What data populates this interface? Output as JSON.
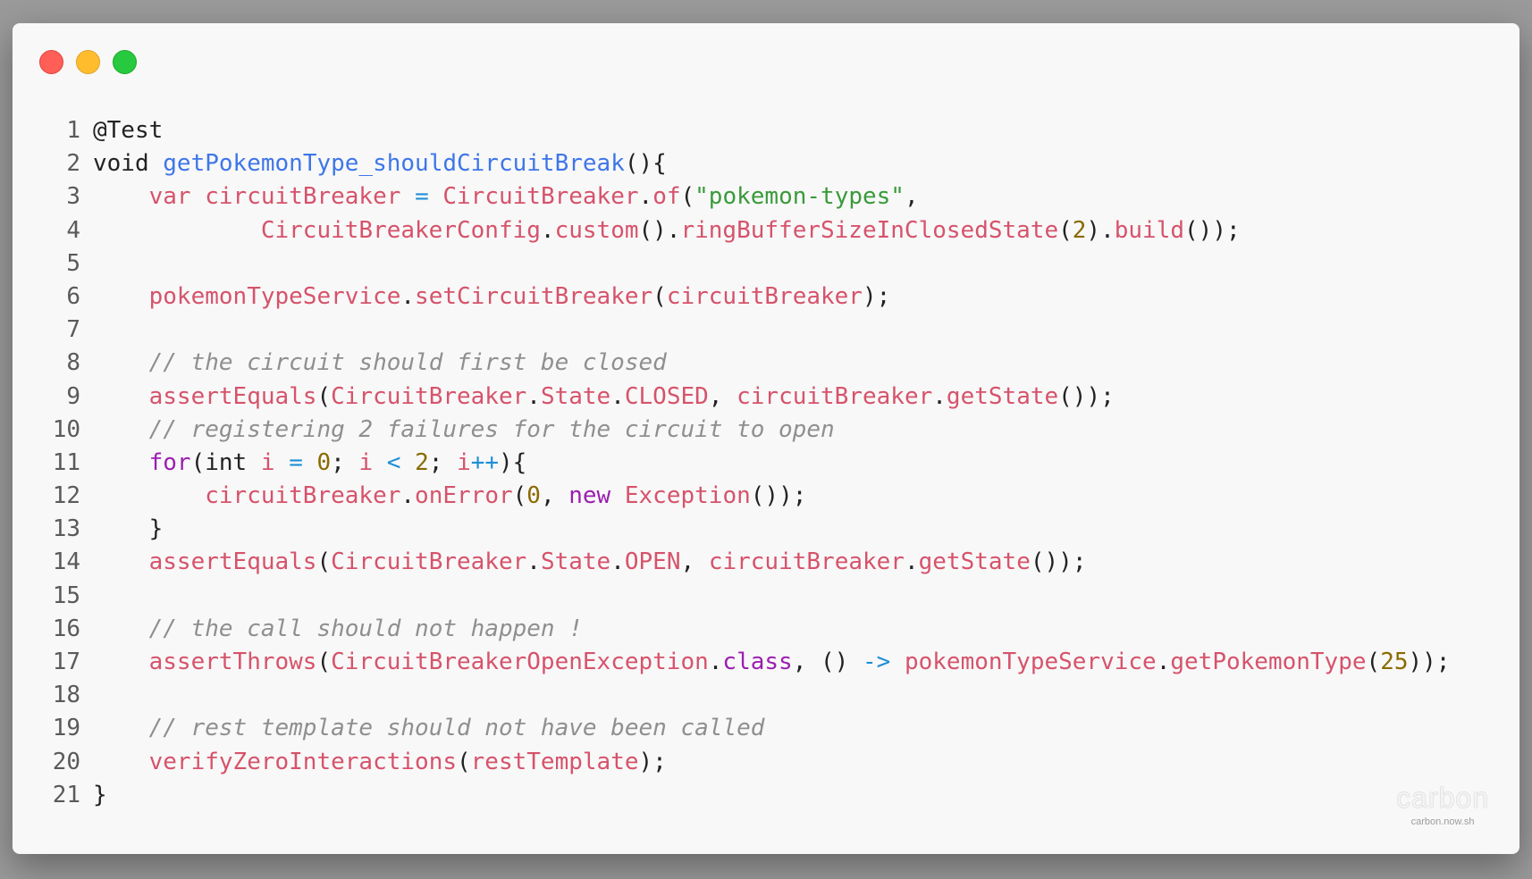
{
  "window": {
    "controls": [
      "close",
      "minimize",
      "maximize"
    ]
  },
  "code": {
    "lines": [
      {
        "number": "1",
        "tokens": [
          {
            "t": "@Test",
            "c": "plain"
          }
        ]
      },
      {
        "number": "2",
        "tokens": [
          {
            "t": "void ",
            "c": "plain"
          },
          {
            "t": "getPokemonType_shouldCircuitBreak",
            "c": "fn"
          },
          {
            "t": "(){",
            "c": "plain"
          }
        ]
      },
      {
        "number": "3",
        "tokens": [
          {
            "t": "    ",
            "c": "plain"
          },
          {
            "t": "var",
            "c": "var"
          },
          {
            "t": " ",
            "c": "plain"
          },
          {
            "t": "circuitBreaker",
            "c": "var"
          },
          {
            "t": " ",
            "c": "plain"
          },
          {
            "t": "=",
            "c": "op"
          },
          {
            "t": " ",
            "c": "plain"
          },
          {
            "t": "CircuitBreaker",
            "c": "var"
          },
          {
            "t": ".",
            "c": "plain"
          },
          {
            "t": "of",
            "c": "var"
          },
          {
            "t": "(",
            "c": "plain"
          },
          {
            "t": "\"pokemon-types\"",
            "c": "str"
          },
          {
            "t": ",",
            "c": "plain"
          }
        ]
      },
      {
        "number": "4",
        "tokens": [
          {
            "t": "            ",
            "c": "plain"
          },
          {
            "t": "CircuitBreakerConfig",
            "c": "var"
          },
          {
            "t": ".",
            "c": "plain"
          },
          {
            "t": "custom",
            "c": "var"
          },
          {
            "t": "().",
            "c": "plain"
          },
          {
            "t": "ringBufferSizeInClosedState",
            "c": "var"
          },
          {
            "t": "(",
            "c": "plain"
          },
          {
            "t": "2",
            "c": "num"
          },
          {
            "t": ").",
            "c": "plain"
          },
          {
            "t": "build",
            "c": "var"
          },
          {
            "t": "());",
            "c": "plain"
          }
        ]
      },
      {
        "number": "5",
        "tokens": []
      },
      {
        "number": "6",
        "tokens": [
          {
            "t": "    ",
            "c": "plain"
          },
          {
            "t": "pokemonTypeService",
            "c": "var"
          },
          {
            "t": ".",
            "c": "plain"
          },
          {
            "t": "setCircuitBreaker",
            "c": "var"
          },
          {
            "t": "(",
            "c": "plain"
          },
          {
            "t": "circuitBreaker",
            "c": "var"
          },
          {
            "t": ");",
            "c": "plain"
          }
        ]
      },
      {
        "number": "7",
        "tokens": []
      },
      {
        "number": "8",
        "tokens": [
          {
            "t": "    ",
            "c": "plain"
          },
          {
            "t": "// the circuit should first be closed",
            "c": "comment"
          }
        ]
      },
      {
        "number": "9",
        "tokens": [
          {
            "t": "    ",
            "c": "plain"
          },
          {
            "t": "assertEquals",
            "c": "var"
          },
          {
            "t": "(",
            "c": "plain"
          },
          {
            "t": "CircuitBreaker",
            "c": "var"
          },
          {
            "t": ".",
            "c": "plain"
          },
          {
            "t": "State",
            "c": "var"
          },
          {
            "t": ".",
            "c": "plain"
          },
          {
            "t": "CLOSED",
            "c": "var"
          },
          {
            "t": ", ",
            "c": "plain"
          },
          {
            "t": "circuitBreaker",
            "c": "var"
          },
          {
            "t": ".",
            "c": "plain"
          },
          {
            "t": "getState",
            "c": "var"
          },
          {
            "t": "());",
            "c": "plain"
          }
        ]
      },
      {
        "number": "10",
        "tokens": [
          {
            "t": "    ",
            "c": "plain"
          },
          {
            "t": "// registering 2 failures for the circuit to open",
            "c": "comment"
          }
        ]
      },
      {
        "number": "11",
        "tokens": [
          {
            "t": "    ",
            "c": "plain"
          },
          {
            "t": "for",
            "c": "kw"
          },
          {
            "t": "(int ",
            "c": "plain"
          },
          {
            "t": "i",
            "c": "var"
          },
          {
            "t": " ",
            "c": "plain"
          },
          {
            "t": "=",
            "c": "op"
          },
          {
            "t": " ",
            "c": "plain"
          },
          {
            "t": "0",
            "c": "num"
          },
          {
            "t": "; ",
            "c": "plain"
          },
          {
            "t": "i",
            "c": "var"
          },
          {
            "t": " ",
            "c": "plain"
          },
          {
            "t": "<",
            "c": "op"
          },
          {
            "t": " ",
            "c": "plain"
          },
          {
            "t": "2",
            "c": "num"
          },
          {
            "t": "; ",
            "c": "plain"
          },
          {
            "t": "i",
            "c": "var"
          },
          {
            "t": "++",
            "c": "op"
          },
          {
            "t": "){",
            "c": "plain"
          }
        ]
      },
      {
        "number": "12",
        "tokens": [
          {
            "t": "        ",
            "c": "plain"
          },
          {
            "t": "circuitBreaker",
            "c": "var"
          },
          {
            "t": ".",
            "c": "plain"
          },
          {
            "t": "onError",
            "c": "var"
          },
          {
            "t": "(",
            "c": "plain"
          },
          {
            "t": "0",
            "c": "num"
          },
          {
            "t": ", ",
            "c": "plain"
          },
          {
            "t": "new",
            "c": "kw"
          },
          {
            "t": " ",
            "c": "plain"
          },
          {
            "t": "Exception",
            "c": "var"
          },
          {
            "t": "());",
            "c": "plain"
          }
        ]
      },
      {
        "number": "13",
        "tokens": [
          {
            "t": "    }",
            "c": "plain"
          }
        ]
      },
      {
        "number": "14",
        "tokens": [
          {
            "t": "    ",
            "c": "plain"
          },
          {
            "t": "assertEquals",
            "c": "var"
          },
          {
            "t": "(",
            "c": "plain"
          },
          {
            "t": "CircuitBreaker",
            "c": "var"
          },
          {
            "t": ".",
            "c": "plain"
          },
          {
            "t": "State",
            "c": "var"
          },
          {
            "t": ".",
            "c": "plain"
          },
          {
            "t": "OPEN",
            "c": "var"
          },
          {
            "t": ", ",
            "c": "plain"
          },
          {
            "t": "circuitBreaker",
            "c": "var"
          },
          {
            "t": ".",
            "c": "plain"
          },
          {
            "t": "getState",
            "c": "var"
          },
          {
            "t": "());",
            "c": "plain"
          }
        ]
      },
      {
        "number": "15",
        "tokens": []
      },
      {
        "number": "16",
        "tokens": [
          {
            "t": "    ",
            "c": "plain"
          },
          {
            "t": "// the call should not happen !",
            "c": "comment"
          }
        ]
      },
      {
        "number": "17",
        "tokens": [
          {
            "t": "    ",
            "c": "plain"
          },
          {
            "t": "assertThrows",
            "c": "var"
          },
          {
            "t": "(",
            "c": "plain"
          },
          {
            "t": "CircuitBreakerOpenException",
            "c": "var"
          },
          {
            "t": ".",
            "c": "plain"
          },
          {
            "t": "class",
            "c": "kw"
          },
          {
            "t": ", () ",
            "c": "plain"
          },
          {
            "t": "->",
            "c": "op"
          },
          {
            "t": " ",
            "c": "plain"
          },
          {
            "t": "pokemonTypeService",
            "c": "var"
          },
          {
            "t": ".",
            "c": "plain"
          },
          {
            "t": "getPokemonType",
            "c": "var"
          },
          {
            "t": "(",
            "c": "plain"
          },
          {
            "t": "25",
            "c": "num"
          },
          {
            "t": "));",
            "c": "plain"
          }
        ]
      },
      {
        "number": "18",
        "tokens": []
      },
      {
        "number": "19",
        "tokens": [
          {
            "t": "    ",
            "c": "plain"
          },
          {
            "t": "// rest template should not have been called",
            "c": "comment"
          }
        ]
      },
      {
        "number": "20",
        "tokens": [
          {
            "t": "    ",
            "c": "plain"
          },
          {
            "t": "verifyZeroInteractions",
            "c": "var"
          },
          {
            "t": "(",
            "c": "plain"
          },
          {
            "t": "restTemplate",
            "c": "var"
          },
          {
            "t": ");",
            "c": "plain"
          }
        ]
      },
      {
        "number": "21",
        "tokens": [
          {
            "t": "}",
            "c": "plain"
          }
        ]
      }
    ]
  },
  "watermark": {
    "brand": "carbon",
    "url": "carbon.now.sh"
  },
  "colors": {
    "background": "#9a9a9a",
    "window": "#f8f8f8",
    "close": "#ff5f56",
    "minimize": "#ffbd2e",
    "maximize": "#27c93f",
    "function_name": "#3e76e8",
    "identifier": "#d6536b",
    "string": "#3a9a3a",
    "number": "#8a6a00",
    "keyword": "#9b1fb0",
    "operator": "#1e8fd6",
    "comment": "#8f8f8f"
  }
}
